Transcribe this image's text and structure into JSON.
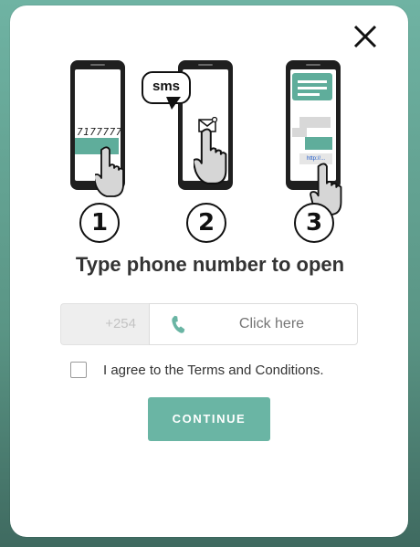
{
  "theme": {
    "accent": "#6ab5a4",
    "overlay": "#5e9f8f"
  },
  "modal": {
    "close_icon": "close-icon",
    "steps": [
      {
        "number": "1",
        "typed_number": "7177777"
      },
      {
        "number": "2",
        "bubble": "sms"
      },
      {
        "number": "3",
        "link": "http://..."
      }
    ],
    "title": "Type phone number to open",
    "phone": {
      "prefix": "+254",
      "icon": "phone-icon",
      "placeholder": "Click here"
    },
    "terms_label": "I agree to the Terms and Conditions.",
    "continue_label": "CONTINUE"
  }
}
